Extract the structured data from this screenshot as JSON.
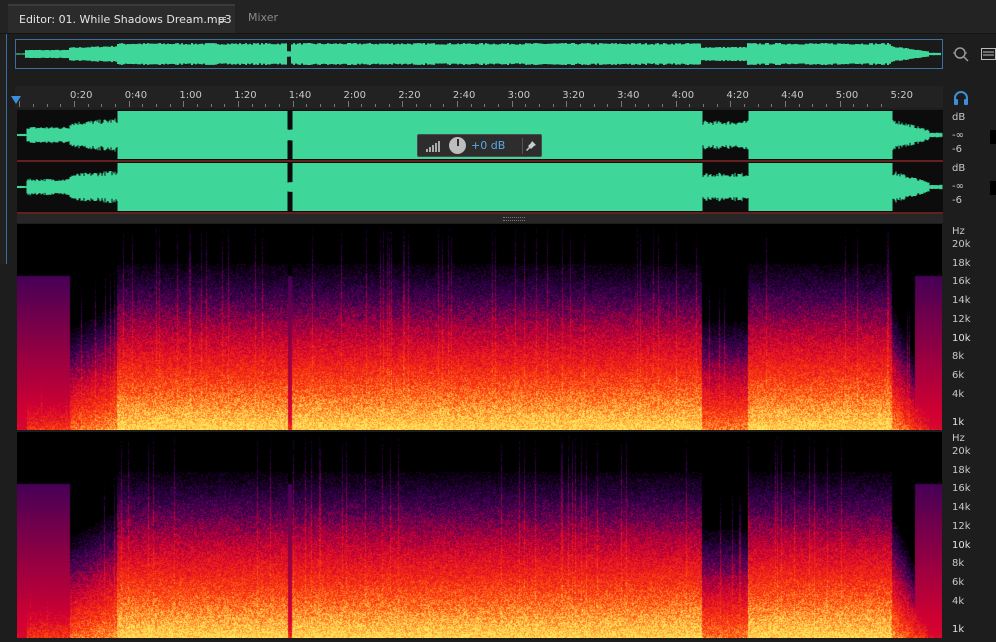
{
  "tabs": {
    "editor_label": "Editor: 01. While Shadows Dream.mp3",
    "mixer_label": "Mixer"
  },
  "ruler": {
    "unit": "hms",
    "labels": [
      "0:20",
      "0:40",
      "1:00",
      "1:20",
      "1:40",
      "2:00",
      "2:20",
      "2:40",
      "3:00",
      "3:20",
      "3:40",
      "4:00",
      "4:20",
      "4:40",
      "5:00",
      "5:20"
    ]
  },
  "gain_hud": {
    "value": "+0 dB"
  },
  "channels": {
    "db_unit": "dB",
    "db_inf": "-∞",
    "db_minus6": "-6"
  },
  "spectral": {
    "unit": "Hz",
    "labels": [
      "20k",
      "18k",
      "16k",
      "14k",
      "12k",
      "10k",
      "8k",
      "6k",
      "4k",
      "1k"
    ]
  },
  "colors": {
    "waveform": "#3fd69a",
    "accent": "#3a8fd8"
  },
  "icons": [
    "zoom-icon",
    "panel-icon",
    "headphones-icon",
    "signal-meter-icon",
    "pin-icon"
  ]
}
